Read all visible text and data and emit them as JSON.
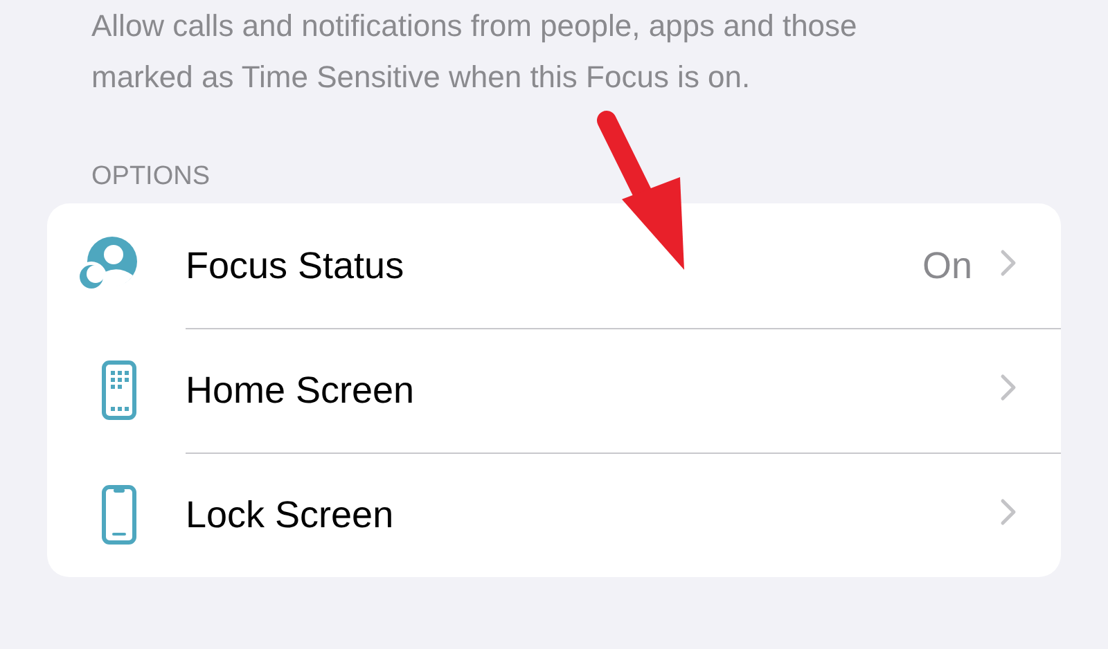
{
  "description": "Allow calls and notifications from people, apps and those marked as Time Sensitive when this Focus is on.",
  "section_header": "OPTIONS",
  "options": [
    {
      "kind": "focus-status",
      "label": "Focus Status",
      "value": "On"
    },
    {
      "kind": "home-screen",
      "label": "Home Screen"
    },
    {
      "kind": "lock-screen",
      "label": "Lock Screen"
    }
  ]
}
